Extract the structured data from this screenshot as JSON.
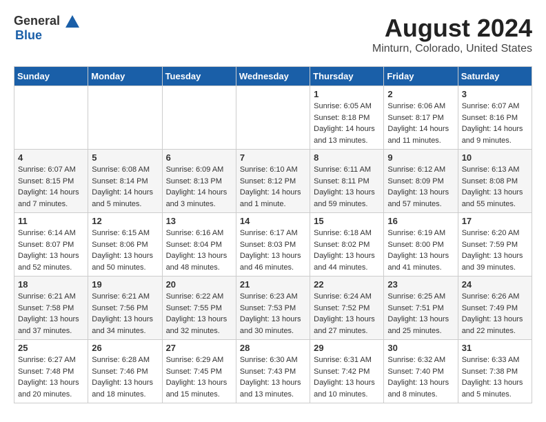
{
  "logo": {
    "general": "General",
    "blue": "Blue"
  },
  "title": "August 2024",
  "subtitle": "Minturn, Colorado, United States",
  "weekdays": [
    "Sunday",
    "Monday",
    "Tuesday",
    "Wednesday",
    "Thursday",
    "Friday",
    "Saturday"
  ],
  "weeks": [
    [
      {
        "day": "",
        "info": ""
      },
      {
        "day": "",
        "info": ""
      },
      {
        "day": "",
        "info": ""
      },
      {
        "day": "",
        "info": ""
      },
      {
        "day": "1",
        "info": "Sunrise: 6:05 AM\nSunset: 8:18 PM\nDaylight: 14 hours\nand 13 minutes."
      },
      {
        "day": "2",
        "info": "Sunrise: 6:06 AM\nSunset: 8:17 PM\nDaylight: 14 hours\nand 11 minutes."
      },
      {
        "day": "3",
        "info": "Sunrise: 6:07 AM\nSunset: 8:16 PM\nDaylight: 14 hours\nand 9 minutes."
      }
    ],
    [
      {
        "day": "4",
        "info": "Sunrise: 6:07 AM\nSunset: 8:15 PM\nDaylight: 14 hours\nand 7 minutes."
      },
      {
        "day": "5",
        "info": "Sunrise: 6:08 AM\nSunset: 8:14 PM\nDaylight: 14 hours\nand 5 minutes."
      },
      {
        "day": "6",
        "info": "Sunrise: 6:09 AM\nSunset: 8:13 PM\nDaylight: 14 hours\nand 3 minutes."
      },
      {
        "day": "7",
        "info": "Sunrise: 6:10 AM\nSunset: 8:12 PM\nDaylight: 14 hours\nand 1 minute."
      },
      {
        "day": "8",
        "info": "Sunrise: 6:11 AM\nSunset: 8:11 PM\nDaylight: 13 hours\nand 59 minutes."
      },
      {
        "day": "9",
        "info": "Sunrise: 6:12 AM\nSunset: 8:09 PM\nDaylight: 13 hours\nand 57 minutes."
      },
      {
        "day": "10",
        "info": "Sunrise: 6:13 AM\nSunset: 8:08 PM\nDaylight: 13 hours\nand 55 minutes."
      }
    ],
    [
      {
        "day": "11",
        "info": "Sunrise: 6:14 AM\nSunset: 8:07 PM\nDaylight: 13 hours\nand 52 minutes."
      },
      {
        "day": "12",
        "info": "Sunrise: 6:15 AM\nSunset: 8:06 PM\nDaylight: 13 hours\nand 50 minutes."
      },
      {
        "day": "13",
        "info": "Sunrise: 6:16 AM\nSunset: 8:04 PM\nDaylight: 13 hours\nand 48 minutes."
      },
      {
        "day": "14",
        "info": "Sunrise: 6:17 AM\nSunset: 8:03 PM\nDaylight: 13 hours\nand 46 minutes."
      },
      {
        "day": "15",
        "info": "Sunrise: 6:18 AM\nSunset: 8:02 PM\nDaylight: 13 hours\nand 44 minutes."
      },
      {
        "day": "16",
        "info": "Sunrise: 6:19 AM\nSunset: 8:00 PM\nDaylight: 13 hours\nand 41 minutes."
      },
      {
        "day": "17",
        "info": "Sunrise: 6:20 AM\nSunset: 7:59 PM\nDaylight: 13 hours\nand 39 minutes."
      }
    ],
    [
      {
        "day": "18",
        "info": "Sunrise: 6:21 AM\nSunset: 7:58 PM\nDaylight: 13 hours\nand 37 minutes."
      },
      {
        "day": "19",
        "info": "Sunrise: 6:21 AM\nSunset: 7:56 PM\nDaylight: 13 hours\nand 34 minutes."
      },
      {
        "day": "20",
        "info": "Sunrise: 6:22 AM\nSunset: 7:55 PM\nDaylight: 13 hours\nand 32 minutes."
      },
      {
        "day": "21",
        "info": "Sunrise: 6:23 AM\nSunset: 7:53 PM\nDaylight: 13 hours\nand 30 minutes."
      },
      {
        "day": "22",
        "info": "Sunrise: 6:24 AM\nSunset: 7:52 PM\nDaylight: 13 hours\nand 27 minutes."
      },
      {
        "day": "23",
        "info": "Sunrise: 6:25 AM\nSunset: 7:51 PM\nDaylight: 13 hours\nand 25 minutes."
      },
      {
        "day": "24",
        "info": "Sunrise: 6:26 AM\nSunset: 7:49 PM\nDaylight: 13 hours\nand 22 minutes."
      }
    ],
    [
      {
        "day": "25",
        "info": "Sunrise: 6:27 AM\nSunset: 7:48 PM\nDaylight: 13 hours\nand 20 minutes."
      },
      {
        "day": "26",
        "info": "Sunrise: 6:28 AM\nSunset: 7:46 PM\nDaylight: 13 hours\nand 18 minutes."
      },
      {
        "day": "27",
        "info": "Sunrise: 6:29 AM\nSunset: 7:45 PM\nDaylight: 13 hours\nand 15 minutes."
      },
      {
        "day": "28",
        "info": "Sunrise: 6:30 AM\nSunset: 7:43 PM\nDaylight: 13 hours\nand 13 minutes."
      },
      {
        "day": "29",
        "info": "Sunrise: 6:31 AM\nSunset: 7:42 PM\nDaylight: 13 hours\nand 10 minutes."
      },
      {
        "day": "30",
        "info": "Sunrise: 6:32 AM\nSunset: 7:40 PM\nDaylight: 13 hours\nand 8 minutes."
      },
      {
        "day": "31",
        "info": "Sunrise: 6:33 AM\nSunset: 7:38 PM\nDaylight: 13 hours\nand 5 minutes."
      }
    ]
  ]
}
